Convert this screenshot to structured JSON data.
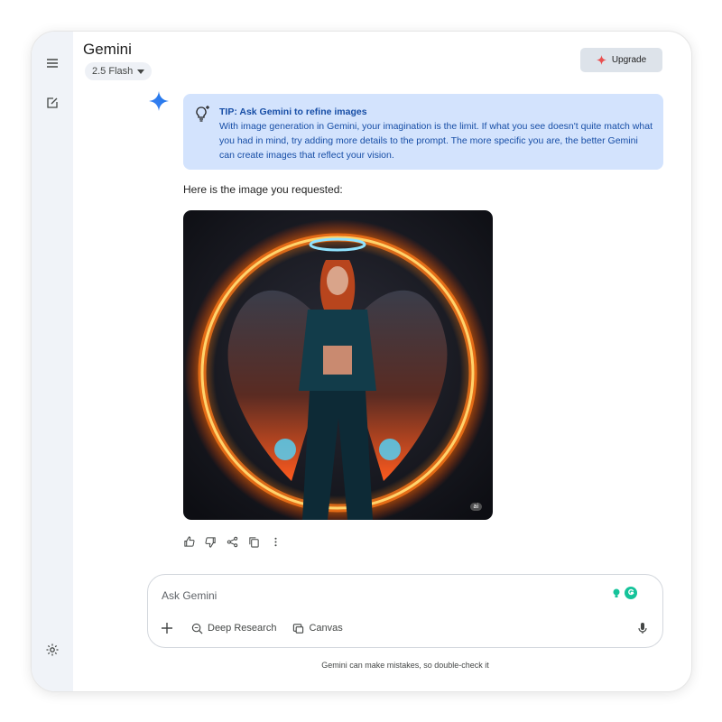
{
  "app": {
    "title": "Gemini",
    "model": "2.5 Flash"
  },
  "header": {
    "upgrade_label": "Upgrade"
  },
  "icons": {
    "menu": "menu-icon",
    "new_chat": "edit-icon",
    "settings": "gear-icon",
    "assistant": "gemini-sparkle-icon",
    "tip": "lightbulb-icon",
    "upgrade": "sparkle-icon"
  },
  "tip": {
    "title": "TIP: Ask Gemini to refine images",
    "body": "With image generation in Gemini, your imagination is the limit. If what you see doesn't quite match what you had in mind, try adding more details to the prompt. The more specific you are, the better Gemini can create images that reflect your vision."
  },
  "response": {
    "text": "Here is the image you requested:",
    "image_badge": "ai"
  },
  "composer": {
    "placeholder": "Ask Gemini",
    "tools": [
      "Deep Research",
      "Canvas"
    ]
  },
  "disclaimer": "Gemini can make mistakes, so double-check it",
  "colors": {
    "accent_blue": "#1a73e8",
    "tip_bg": "#d3e3fd",
    "tip_text": "#174ea6",
    "upgrade_star": "#e94f4f",
    "rail_bg": "#f0f3f8"
  }
}
